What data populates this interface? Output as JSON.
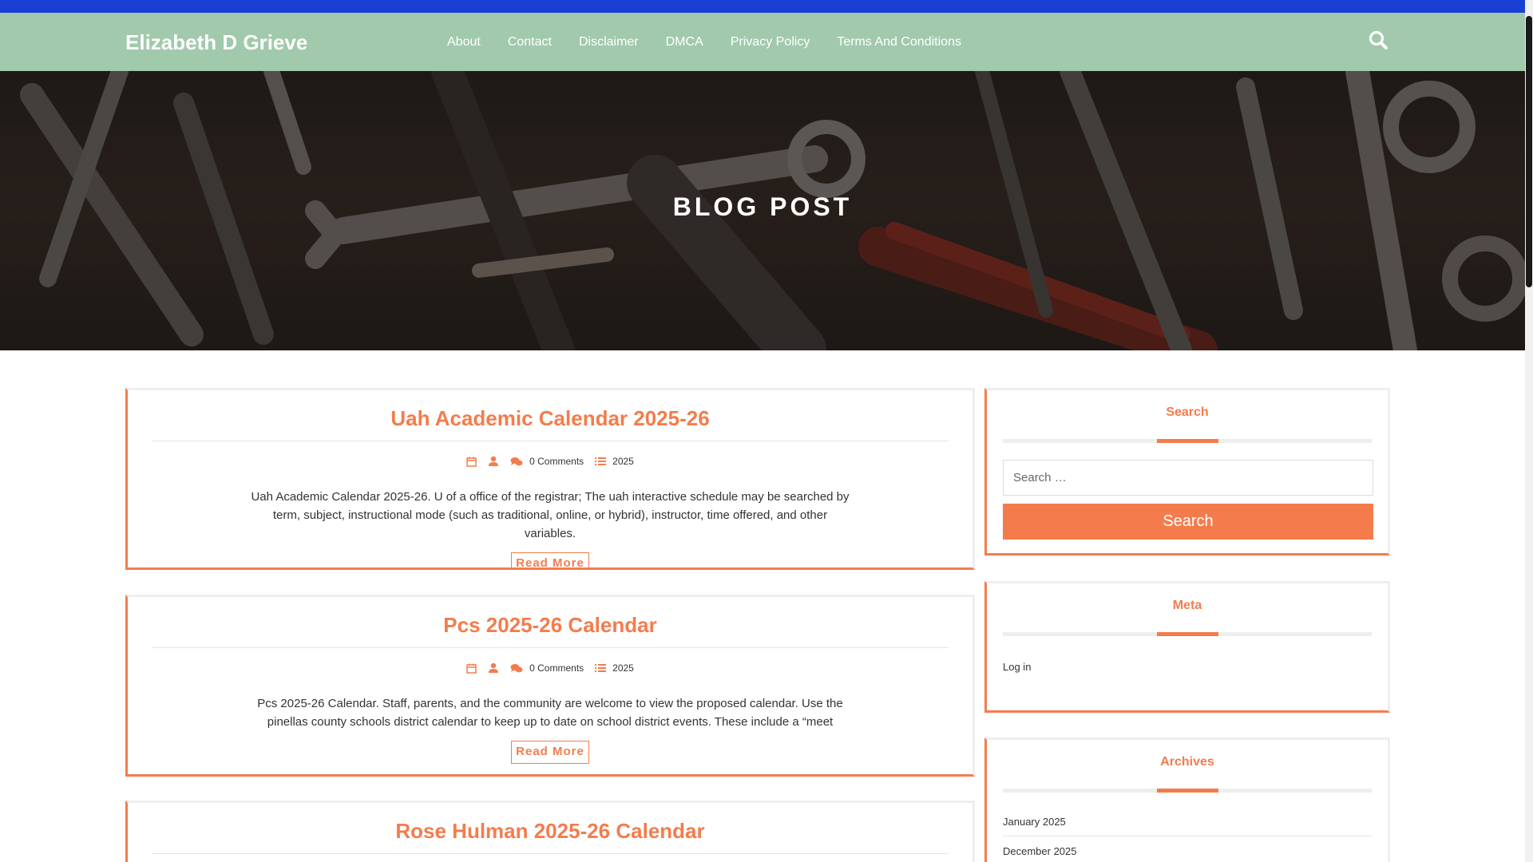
{
  "site": {
    "title": "Elizabeth D Grieve",
    "nav": [
      "About",
      "Contact",
      "Disclaimer",
      "DMCA",
      "Privacy Policy",
      "Terms And Conditions"
    ],
    "search_icon": "search-icon"
  },
  "hero": {
    "title": "BLOG POST"
  },
  "posts": [
    {
      "title": "Uah Academic Calendar 2025-26",
      "comments": "0 Comments",
      "category": "2025",
      "excerpt": "Uah Academic Calendar 2025-26. U of a office of the registrar; The uah interactive schedule may be searched by term, subject, instructional mode (such as traditional, online, or hybrid), instructor, time offered, and other variables.",
      "read_more": "Read More"
    },
    {
      "title": "Pcs 2025-26 Calendar",
      "comments": "0 Comments",
      "category": "2025",
      "excerpt": "Pcs 2025-26 Calendar. Staff, parents, and the community are welcome to view the proposed calendar. Use the pinellas county schools district calendar to keep up to date on school district events. These include a “meet",
      "read_more": "Read More"
    },
    {
      "title": "Rose Hulman 2025-26 Calendar"
    }
  ],
  "sidebar": {
    "search": {
      "title": "Search",
      "placeholder": "Search …",
      "button": "Search"
    },
    "meta": {
      "title": "Meta",
      "items": [
        "Log in"
      ]
    },
    "archives": {
      "title": "Archives",
      "items": [
        "January 2025",
        "December 2025"
      ]
    }
  },
  "colors": {
    "accent": "#f47c4c",
    "header_bg": "#a1c9ac",
    "topbar": "#1a3fd4"
  }
}
